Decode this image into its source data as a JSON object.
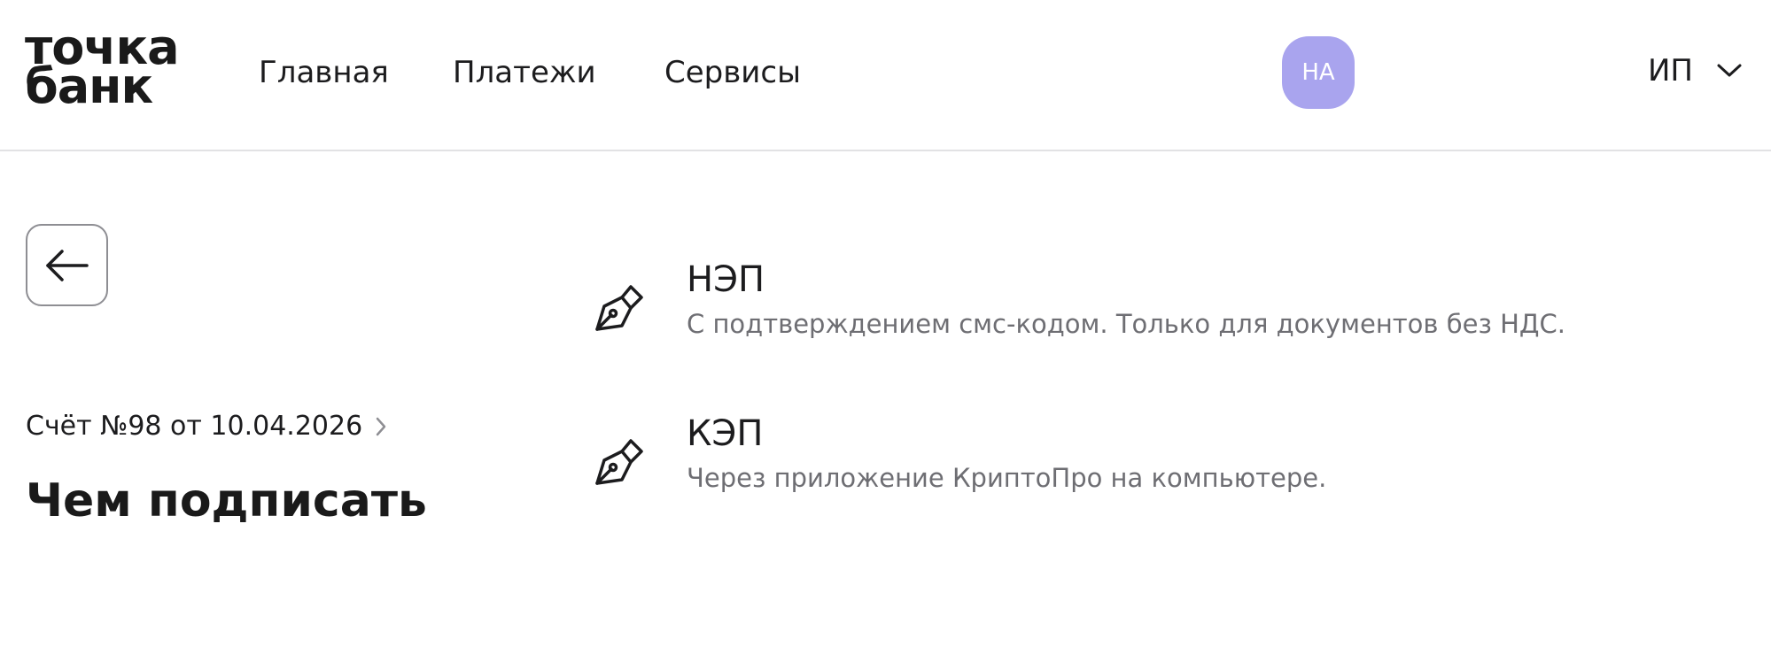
{
  "header": {
    "logo_line1": "точка",
    "logo_line2": "банк",
    "nav": [
      {
        "label": "Главная"
      },
      {
        "label": "Платежи"
      },
      {
        "label": "Сервисы"
      }
    ],
    "avatar_initials": "НА",
    "avatar_color": "#a9a4ee",
    "org_label": "ИП"
  },
  "main": {
    "back_icon": "arrow-left-icon",
    "breadcrumb": "Счёт №98 от 10.04.2026",
    "title": "Чем подписать",
    "options": [
      {
        "icon": "pen-nib-icon",
        "title": "НЭП",
        "description": "С подтверждением смс-кодом. Только для документов без НДС."
      },
      {
        "icon": "pen-nib-icon",
        "title": "КЭП",
        "description": "Через приложение КриптоПро на компьютере."
      }
    ]
  }
}
